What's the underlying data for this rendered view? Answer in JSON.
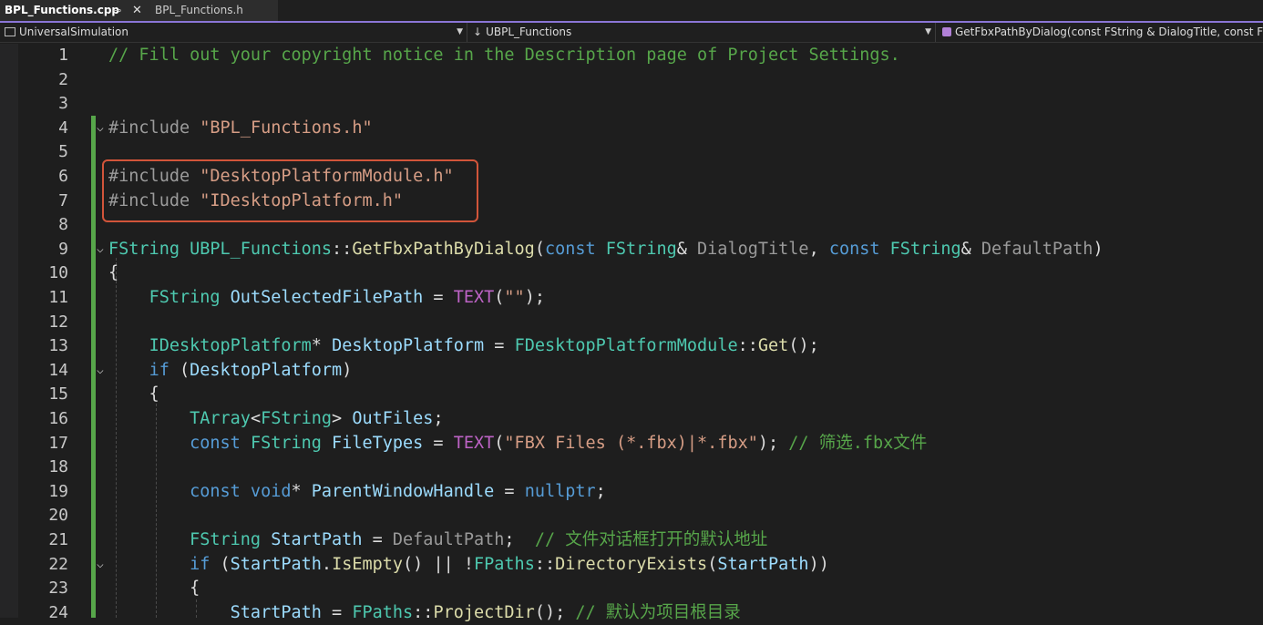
{
  "tabs": {
    "active": "BPL_Functions.cpp",
    "pin_icon": "pin-icon",
    "close_icon": "close-icon",
    "inactive": "BPL_Functions.h"
  },
  "nav": {
    "project": "UniversalSimulation",
    "class_scope": "UBPL_Functions",
    "member": "GetFbxPathByDialog(const FString & DialogTitle, const FStri"
  },
  "lines": [
    {
      "n": "1",
      "segs": [
        {
          "c": "com",
          "t": "// Fill out your copyright notice in the Description page of Project Settings."
        }
      ]
    },
    {
      "n": "2",
      "segs": []
    },
    {
      "n": "3",
      "segs": []
    },
    {
      "n": "4",
      "fold": true,
      "segs": [
        {
          "c": "pre",
          "t": "#include "
        },
        {
          "c": "str",
          "t": "\"BPL_Functions.h\""
        }
      ]
    },
    {
      "n": "5",
      "segs": []
    },
    {
      "n": "6",
      "segs": [
        {
          "c": "pre",
          "t": "#include "
        },
        {
          "c": "str",
          "t": "\"DesktopPlatformModule.h\""
        }
      ]
    },
    {
      "n": "7",
      "segs": [
        {
          "c": "pre",
          "t": "#include "
        },
        {
          "c": "str",
          "t": "\"IDesktopPlatform.h\""
        }
      ]
    },
    {
      "n": "8",
      "segs": []
    },
    {
      "n": "9",
      "fold": true,
      "segs": [
        {
          "c": "typ",
          "t": "FString "
        },
        {
          "c": "typ",
          "t": "UBPL_Functions"
        },
        {
          "c": "def",
          "t": "::"
        },
        {
          "c": "fn",
          "t": "GetFbxPathByDialog"
        },
        {
          "c": "def",
          "t": "("
        },
        {
          "c": "kw",
          "t": "const "
        },
        {
          "c": "typ",
          "t": "FString"
        },
        {
          "c": "def",
          "t": "& "
        },
        {
          "c": "par",
          "t": "DialogTitle"
        },
        {
          "c": "def",
          "t": ", "
        },
        {
          "c": "kw",
          "t": "const "
        },
        {
          "c": "typ",
          "t": "FString"
        },
        {
          "c": "def",
          "t": "& "
        },
        {
          "c": "par",
          "t": "DefaultPath"
        },
        {
          "c": "def",
          "t": ")"
        }
      ]
    },
    {
      "n": "10",
      "segs": [
        {
          "c": "def",
          "t": "{"
        }
      ]
    },
    {
      "n": "11",
      "segs": [
        {
          "c": "def",
          "t": "    "
        },
        {
          "c": "typ",
          "t": "FString "
        },
        {
          "c": "var",
          "t": "OutSelectedFilePath"
        },
        {
          "c": "def",
          "t": " = "
        },
        {
          "c": "mac",
          "t": "TEXT"
        },
        {
          "c": "def",
          "t": "("
        },
        {
          "c": "str",
          "t": "\"\""
        },
        {
          "c": "def",
          "t": ");"
        }
      ]
    },
    {
      "n": "12",
      "segs": []
    },
    {
      "n": "13",
      "segs": [
        {
          "c": "def",
          "t": "    "
        },
        {
          "c": "typ",
          "t": "IDesktopPlatform"
        },
        {
          "c": "def",
          "t": "* "
        },
        {
          "c": "var",
          "t": "DesktopPlatform"
        },
        {
          "c": "def",
          "t": " = "
        },
        {
          "c": "typ",
          "t": "FDesktopPlatformModule"
        },
        {
          "c": "def",
          "t": "::"
        },
        {
          "c": "fn",
          "t": "Get"
        },
        {
          "c": "def",
          "t": "();"
        }
      ]
    },
    {
      "n": "14",
      "fold": true,
      "segs": [
        {
          "c": "def",
          "t": "    "
        },
        {
          "c": "kw",
          "t": "if "
        },
        {
          "c": "def",
          "t": "("
        },
        {
          "c": "var",
          "t": "DesktopPlatform"
        },
        {
          "c": "def",
          "t": ")"
        }
      ]
    },
    {
      "n": "15",
      "segs": [
        {
          "c": "def",
          "t": "    {"
        }
      ]
    },
    {
      "n": "16",
      "segs": [
        {
          "c": "def",
          "t": "        "
        },
        {
          "c": "typ",
          "t": "TArray"
        },
        {
          "c": "def",
          "t": "<"
        },
        {
          "c": "typ",
          "t": "FString"
        },
        {
          "c": "def",
          "t": "> "
        },
        {
          "c": "var",
          "t": "OutFiles"
        },
        {
          "c": "def",
          "t": ";"
        }
      ]
    },
    {
      "n": "17",
      "segs": [
        {
          "c": "def",
          "t": "        "
        },
        {
          "c": "kw",
          "t": "const "
        },
        {
          "c": "typ",
          "t": "FString "
        },
        {
          "c": "var",
          "t": "FileTypes"
        },
        {
          "c": "def",
          "t": " = "
        },
        {
          "c": "mac",
          "t": "TEXT"
        },
        {
          "c": "def",
          "t": "("
        },
        {
          "c": "str",
          "t": "\"FBX Files (*.fbx)|*.fbx\""
        },
        {
          "c": "def",
          "t": "); "
        },
        {
          "c": "com",
          "t": "// 筛选.fbx文件"
        }
      ]
    },
    {
      "n": "18",
      "segs": []
    },
    {
      "n": "19",
      "segs": [
        {
          "c": "def",
          "t": "        "
        },
        {
          "c": "kw",
          "t": "const void"
        },
        {
          "c": "def",
          "t": "* "
        },
        {
          "c": "var",
          "t": "ParentWindowHandle"
        },
        {
          "c": "def",
          "t": " = "
        },
        {
          "c": "kw",
          "t": "nullptr"
        },
        {
          "c": "def",
          "t": ";"
        }
      ]
    },
    {
      "n": "20",
      "segs": []
    },
    {
      "n": "21",
      "segs": [
        {
          "c": "def",
          "t": "        "
        },
        {
          "c": "typ",
          "t": "FString "
        },
        {
          "c": "var",
          "t": "StartPath"
        },
        {
          "c": "def",
          "t": " = "
        },
        {
          "c": "par",
          "t": "DefaultPath"
        },
        {
          "c": "def",
          "t": ";  "
        },
        {
          "c": "com",
          "t": "// 文件对话框打开的默认地址"
        }
      ]
    },
    {
      "n": "22",
      "fold": true,
      "segs": [
        {
          "c": "def",
          "t": "        "
        },
        {
          "c": "kw",
          "t": "if "
        },
        {
          "c": "def",
          "t": "("
        },
        {
          "c": "var",
          "t": "StartPath"
        },
        {
          "c": "def",
          "t": "."
        },
        {
          "c": "fn",
          "t": "IsEmpty"
        },
        {
          "c": "def",
          "t": "() || !"
        },
        {
          "c": "typ",
          "t": "FPaths"
        },
        {
          "c": "def",
          "t": "::"
        },
        {
          "c": "fn",
          "t": "DirectoryExists"
        },
        {
          "c": "def",
          "t": "("
        },
        {
          "c": "var",
          "t": "StartPath"
        },
        {
          "c": "def",
          "t": "))"
        }
      ]
    },
    {
      "n": "23",
      "segs": [
        {
          "c": "def",
          "t": "        {"
        }
      ]
    },
    {
      "n": "24",
      "segs": [
        {
          "c": "def",
          "t": "            "
        },
        {
          "c": "var",
          "t": "StartPath"
        },
        {
          "c": "def",
          "t": " = "
        },
        {
          "c": "typ",
          "t": "FPaths"
        },
        {
          "c": "def",
          "t": "::"
        },
        {
          "c": "fn",
          "t": "ProjectDir"
        },
        {
          "c": "def",
          "t": "(); "
        },
        {
          "c": "com",
          "t": "// 默认为项目根目录"
        }
      ]
    }
  ]
}
